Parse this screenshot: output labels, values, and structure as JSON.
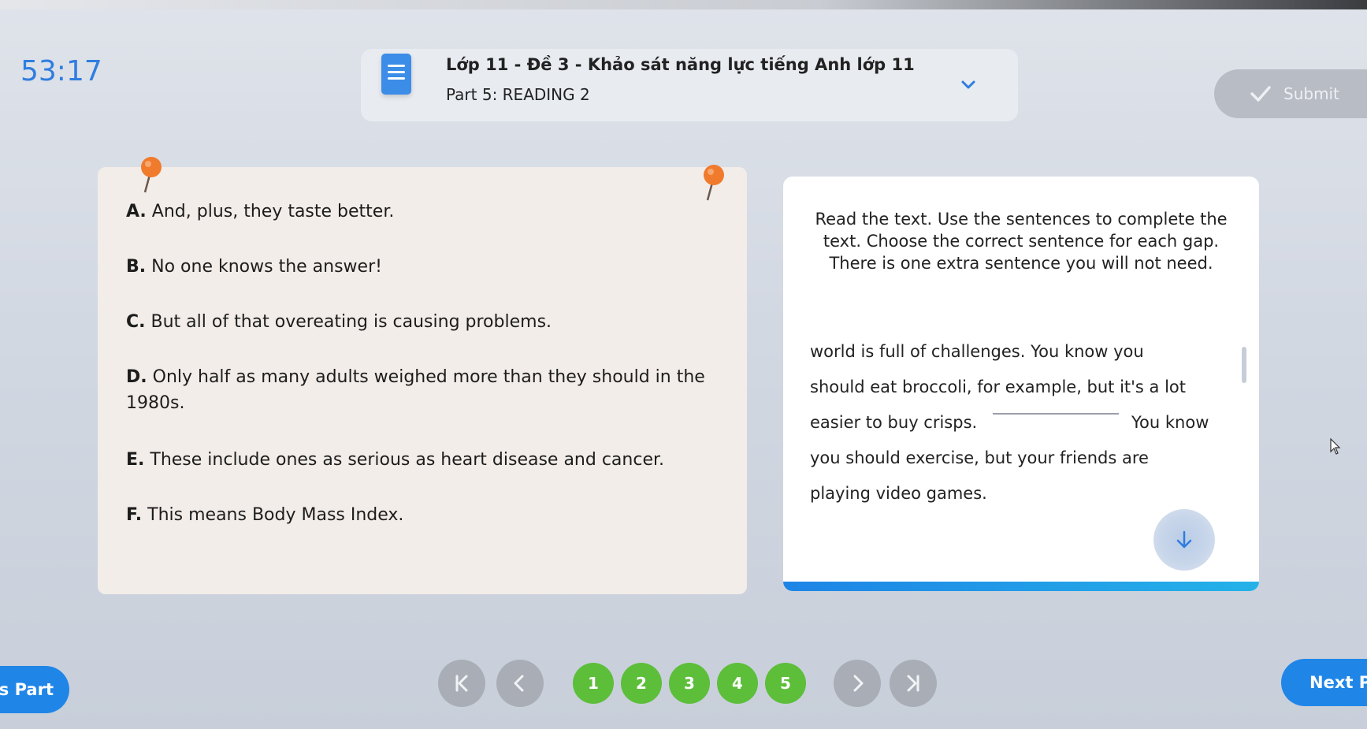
{
  "timer": "53:17",
  "header": {
    "title": "Lớp 11 - Đề 3 - Khảo sát năng lực tiếng Anh lớp 11",
    "part": "Part 5: READING 2",
    "doc_icon": "document-icon",
    "dropdown_icon": "chevron-down-icon"
  },
  "submit": {
    "label": "Submit",
    "icon": "check-icon"
  },
  "options": [
    {
      "letter": "A.",
      "text": "And, plus, they taste better."
    },
    {
      "letter": "B.",
      "text": "No one knows the answer!"
    },
    {
      "letter": "C.",
      "text": "But all of that overeating is causing problems."
    },
    {
      "letter": "D.",
      "text": "Only half as many adults weighed more than they should in the 1980s."
    },
    {
      "letter": "E.",
      "text": "These include ones as serious as heart disease and cancer."
    },
    {
      "letter": "F.",
      "text": "This means Body Mass Index."
    }
  ],
  "instruction": "Read the text. Use the sentences to complete the text. Choose the correct sentence for each gap. There is one extra sentence you will not need.",
  "passage": {
    "line1": "world is full of challenges. You know you",
    "line2": "should eat broccoli, for example, but it's a lot",
    "line3a": "easier to buy crisps.",
    "line3b": "You know",
    "line4": "you should exercise, but your friends are",
    "line5": "playing video games."
  },
  "reading_progress": 1.0,
  "navigation": {
    "prev_part": "us Part",
    "next_part": "Next Pa",
    "pages": [
      "1",
      "2",
      "3",
      "4",
      "5"
    ],
    "first_icon": "skip-first-icon",
    "prev_icon": "chevron-left-icon",
    "next_icon": "chevron-right-icon",
    "last_icon": "skip-last-icon"
  },
  "colors": {
    "accent": "#1f86e8",
    "timer": "#2f7de0",
    "page_answered": "#5dbe3a",
    "pin": "#f07b2c"
  }
}
